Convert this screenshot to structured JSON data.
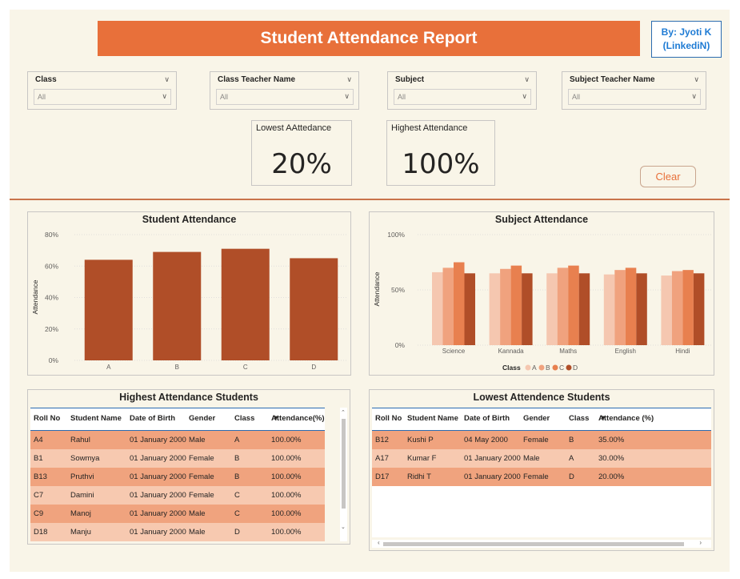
{
  "header": {
    "title": "Student Attendance Report",
    "author_line1": "By: Jyoti K",
    "author_line2": "(LinkediN)"
  },
  "slicers": [
    {
      "label": "Class",
      "value": "All"
    },
    {
      "label": "Class Teacher Name",
      "value": "All"
    },
    {
      "label": "Subject",
      "value": "All"
    },
    {
      "label": "Subject Teacher Name",
      "value": "All"
    }
  ],
  "cards": {
    "lowest": {
      "label": "Lowest AAttedance",
      "value": "20%"
    },
    "highest": {
      "label": "Highest Attendance",
      "value": "100%"
    }
  },
  "clear_label": "Clear",
  "colors": {
    "accent": "#e8703a",
    "bar": "#b04e28",
    "classA": "#f5c7b0",
    "classB": "#f0a27e",
    "classC": "#e8804f",
    "classD": "#b04e28"
  },
  "chart_data": [
    {
      "type": "bar",
      "title": "Student Attendance",
      "ylabel": "Attendance",
      "xlabel": "",
      "categories": [
        "A",
        "B",
        "C",
        "D"
      ],
      "values": [
        64,
        69,
        71,
        65
      ],
      "ylim": [
        0,
        80
      ],
      "yticks": [
        "0%",
        "20%",
        "40%",
        "60%",
        "80%"
      ],
      "grid": true
    },
    {
      "type": "bar",
      "title": "Subject Attendance",
      "ylabel": "Attendance",
      "categories": [
        "Science",
        "Kannada",
        "Maths",
        "English",
        "Hindi"
      ],
      "legend_title": "Class",
      "legend_position": "bottom",
      "series": [
        {
          "name": "A",
          "values": [
            66,
            65,
            65,
            64,
            63
          ]
        },
        {
          "name": "B",
          "values": [
            70,
            69,
            70,
            68,
            67
          ]
        },
        {
          "name": "C",
          "values": [
            75,
            72,
            72,
            70,
            68
          ]
        },
        {
          "name": "D",
          "values": [
            65,
            65,
            65,
            65,
            65
          ]
        }
      ],
      "ylim": [
        0,
        100
      ],
      "yticks": [
        "0%",
        "50%",
        "100%"
      ],
      "grid": true
    }
  ],
  "high_table": {
    "title": "Highest Attendance Students",
    "columns": [
      "Roll No",
      "Student Name",
      "Date of Birth",
      "Gender",
      "Class",
      "Attendance(%)"
    ],
    "rows": [
      [
        "A4",
        "Rahul",
        "01 January 2000",
        "Male",
        "A",
        "100.00%"
      ],
      [
        "B1",
        "Sowmya",
        "01 January 2000",
        "Female",
        "B",
        "100.00%"
      ],
      [
        "B13",
        "Pruthvi",
        "01 January 2000",
        "Female",
        "B",
        "100.00%"
      ],
      [
        "C7",
        "Damini",
        "01 January 2000",
        "Female",
        "C",
        "100.00%"
      ],
      [
        "C9",
        "Manoj",
        "01 January 2000",
        "Male",
        "C",
        "100.00%"
      ],
      [
        "D18",
        "Manju",
        "01 January 2000",
        "Male",
        "D",
        "100.00%"
      ]
    ]
  },
  "low_table": {
    "title": "Lowest Attendence Students",
    "columns": [
      "Roll No",
      "Student Name",
      "Date of Birth",
      "Gender",
      "Class",
      "Attendance (%)"
    ],
    "rows": [
      [
        "B12",
        "Kushi P",
        "04 May 2000",
        "Female",
        "B",
        "35.00%"
      ],
      [
        "A17",
        "Kumar F",
        "01 January 2000",
        "Male",
        "A",
        "30.00%"
      ],
      [
        "D17",
        "Ridhi T",
        "01 January 2000",
        "Female",
        "D",
        "20.00%"
      ]
    ]
  }
}
